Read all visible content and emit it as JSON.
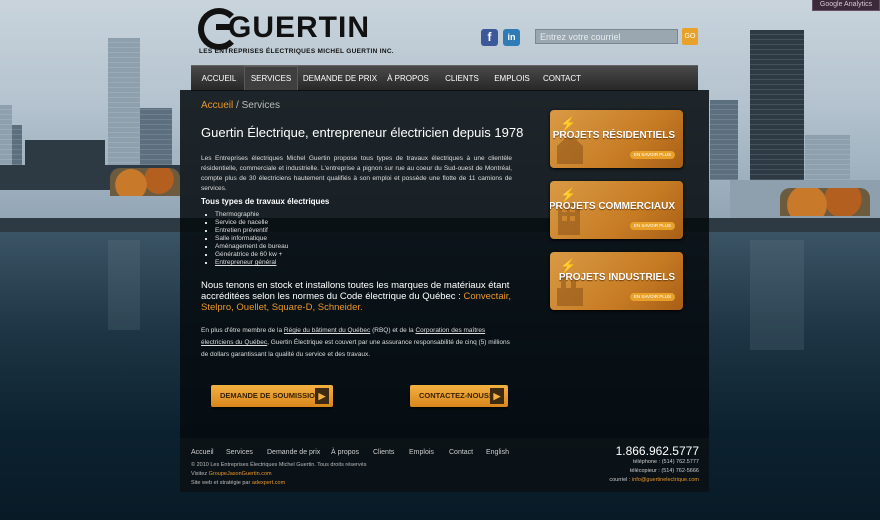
{
  "header": {
    "logo_word": "GUERTIN",
    "logo_tagline": "LES ENTREPRISES ÉLECTRIQUES MICHEL GUERTIN INC.",
    "facebook_icon": "f",
    "linkedin_icon": "in",
    "newsletter_placeholder": "Entrez votre courriel",
    "newsletter_button": "GO",
    "ga_badge": "Google Analytics"
  },
  "nav": {
    "items": [
      "ACCUEIL",
      "SERVICES",
      "DEMANDE DE PRIX",
      "À PROPOS",
      "CLIENTS",
      "EMPLOIS",
      "CONTACT"
    ],
    "active": "SERVICES"
  },
  "breadcrumb": {
    "home": "Accueil",
    "sep": " / ",
    "current": "Services"
  },
  "main": {
    "title": "Guertin Électrique, entrepreneur électricien depuis 1978",
    "intro": "Les Entreprises électriques Michel Guertin propose tous types de travaux électriques à une clientèle résidentielle, commerciale et industrielle. L'entreprise a pignon sur rue au coeur du Sud-ouest de Montréal, compte plus de 30 électriciens hautement qualifiés à son emploi et possède une flotte de 11 camions de services.",
    "services_heading": "Tous types de travaux électriques",
    "services": [
      "Thermographie",
      "Service de nacelle",
      "Entretien préventif",
      "Salle informatique",
      "Aménagement de bureau",
      "Génératrice de 60 kw +",
      "Entrepreneur général"
    ],
    "brands_text": "Nous tenons en stock et installons toutes les marques de matériaux étant accréditées selon les normes du Code électrique du Québec :",
    "brands": [
      "Convectair,",
      "Stelpro,",
      "Ouellet,",
      "Square-D,",
      "Schneider."
    ],
    "member_p1": "En plus d'être membre de la",
    "member_rbq": "Régie du bâtiment du Québec",
    "member_p2": "(RBQ) et de la",
    "member_cmeq": "Corporation des maîtres électriciens du Québec",
    "member_p3": ", Guertin Électrique est couvert par une assurance responsabilité de cinq (5) millions de dollars garantissant la qualité du service et des travaux.",
    "cta_quote": "DEMANDE DE SOUMISSION",
    "cta_contact": "CONTACTEZ-NOUS!"
  },
  "projects": [
    {
      "title": "PROJETS RÉSIDENTIELS",
      "more": "EN SAVOIR PLUS"
    },
    {
      "title": "PROJETS COMMERCIAUX",
      "more": "EN SAVOIR PLUS"
    },
    {
      "title": "PROJETS INDUSTRIELS",
      "more": "EN SAVOIR PLUS"
    }
  ],
  "footer": {
    "nav": [
      "Accueil",
      "Services",
      "Demande de prix",
      "À propos",
      "Clients",
      "Emplois",
      "Contact",
      "English"
    ],
    "copyright": "© 2010 Les Entreprises Électriques Michel Guertin. Tous droits réservés",
    "visit_label": "Visitez",
    "visit_link": "GroupeJasonGuertin.com",
    "credit_label": "Site web et stratégie par",
    "credit_link": "adexpert.com",
    "phone": "1.866.962.5777",
    "tel_label": "téléphone :",
    "tel": "(514) 762.5777",
    "fax_label": "télécopieur :",
    "fax": "(514) 762-5666",
    "email_label": "courriel :",
    "email": "info@guertinelectrique.com"
  },
  "colors": {
    "accent": "#e8962a",
    "nav_bg": "#2e2e2e",
    "panel_bg": "#050a0e",
    "card": "#c77c24"
  }
}
